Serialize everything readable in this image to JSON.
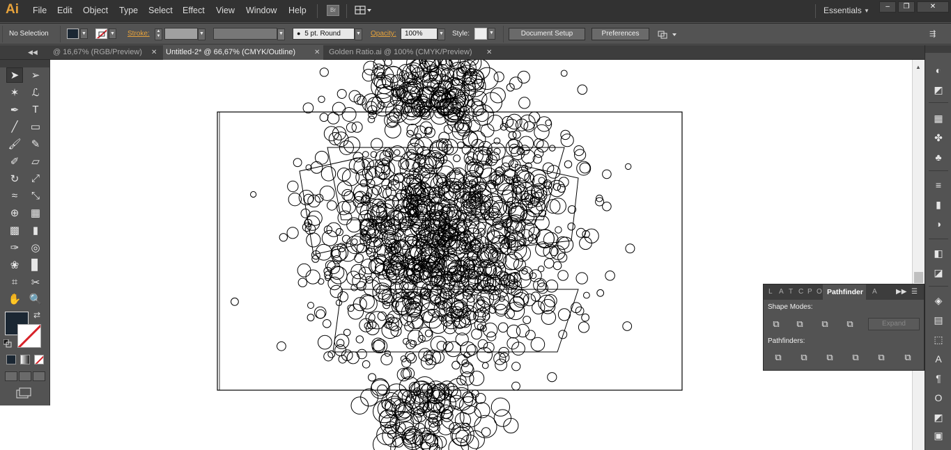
{
  "app": {
    "logo": "Ai"
  },
  "menu": [
    "File",
    "Edit",
    "Object",
    "Type",
    "Select",
    "Effect",
    "View",
    "Window",
    "Help"
  ],
  "bridge_label": "Br",
  "workspace": "Essentials",
  "window_buttons": {
    "minimize": "–",
    "restore": "❐",
    "close": "✕"
  },
  "control": {
    "selection": "No Selection",
    "stroke_label": "Stroke:",
    "brush": "5 pt. Round",
    "opacity_label": "Opacity:",
    "opacity_value": "100%",
    "style_label": "Style:",
    "document_setup": "Document Setup",
    "preferences": "Preferences",
    "fill_color": "#1b2733"
  },
  "tabs": [
    {
      "label": "@ 16,67% (RGB/Preview)",
      "active": false
    },
    {
      "label": "Untitled-2* @ 66,67% (CMYK/Outline)",
      "active": true
    },
    {
      "label": "Golden Ratio.ai @ 100% (CMYK/Preview)",
      "active": false
    }
  ],
  "pathfinder": {
    "tabs": [
      "L",
      "A",
      "T",
      "C",
      "P",
      "O"
    ],
    "active_tab": "Pathfinder",
    "extra_tab": "A",
    "shape_modes_label": "Shape Modes:",
    "pathfinders_label": "Pathfinders:",
    "expand_label": "Expand"
  },
  "tools": [
    "selection-tool",
    "direct-selection-tool",
    "magic-wand-tool",
    "lasso-tool",
    "pen-tool",
    "type-tool",
    "line-segment-tool",
    "rectangle-tool",
    "paintbrush-tool",
    "pencil-tool",
    "blob-brush-tool",
    "eraser-tool",
    "rotate-tool",
    "scale-tool",
    "width-tool",
    "free-transform-tool",
    "shape-builder-tool",
    "perspective-grid-tool",
    "mesh-tool",
    "gradient-tool",
    "eyedropper-tool",
    "blend-tool",
    "symbol-sprayer-tool",
    "column-graph-tool",
    "artboard-tool",
    "slice-tool",
    "hand-tool",
    "zoom-tool"
  ],
  "dock_icons": [
    "color-guide-icon",
    "color-icon",
    "swatches-icon",
    "brushes-icon",
    "symbols-icon",
    "stroke-icon",
    "gradient-icon",
    "transparency-icon",
    "appearance-icon",
    "graphic-styles-icon",
    "layers-icon",
    "align-icon",
    "transform-icon",
    "character-icon",
    "paragraph-icon",
    "opentype-icon",
    "pathfinder-icon",
    "artboards-icon"
  ]
}
